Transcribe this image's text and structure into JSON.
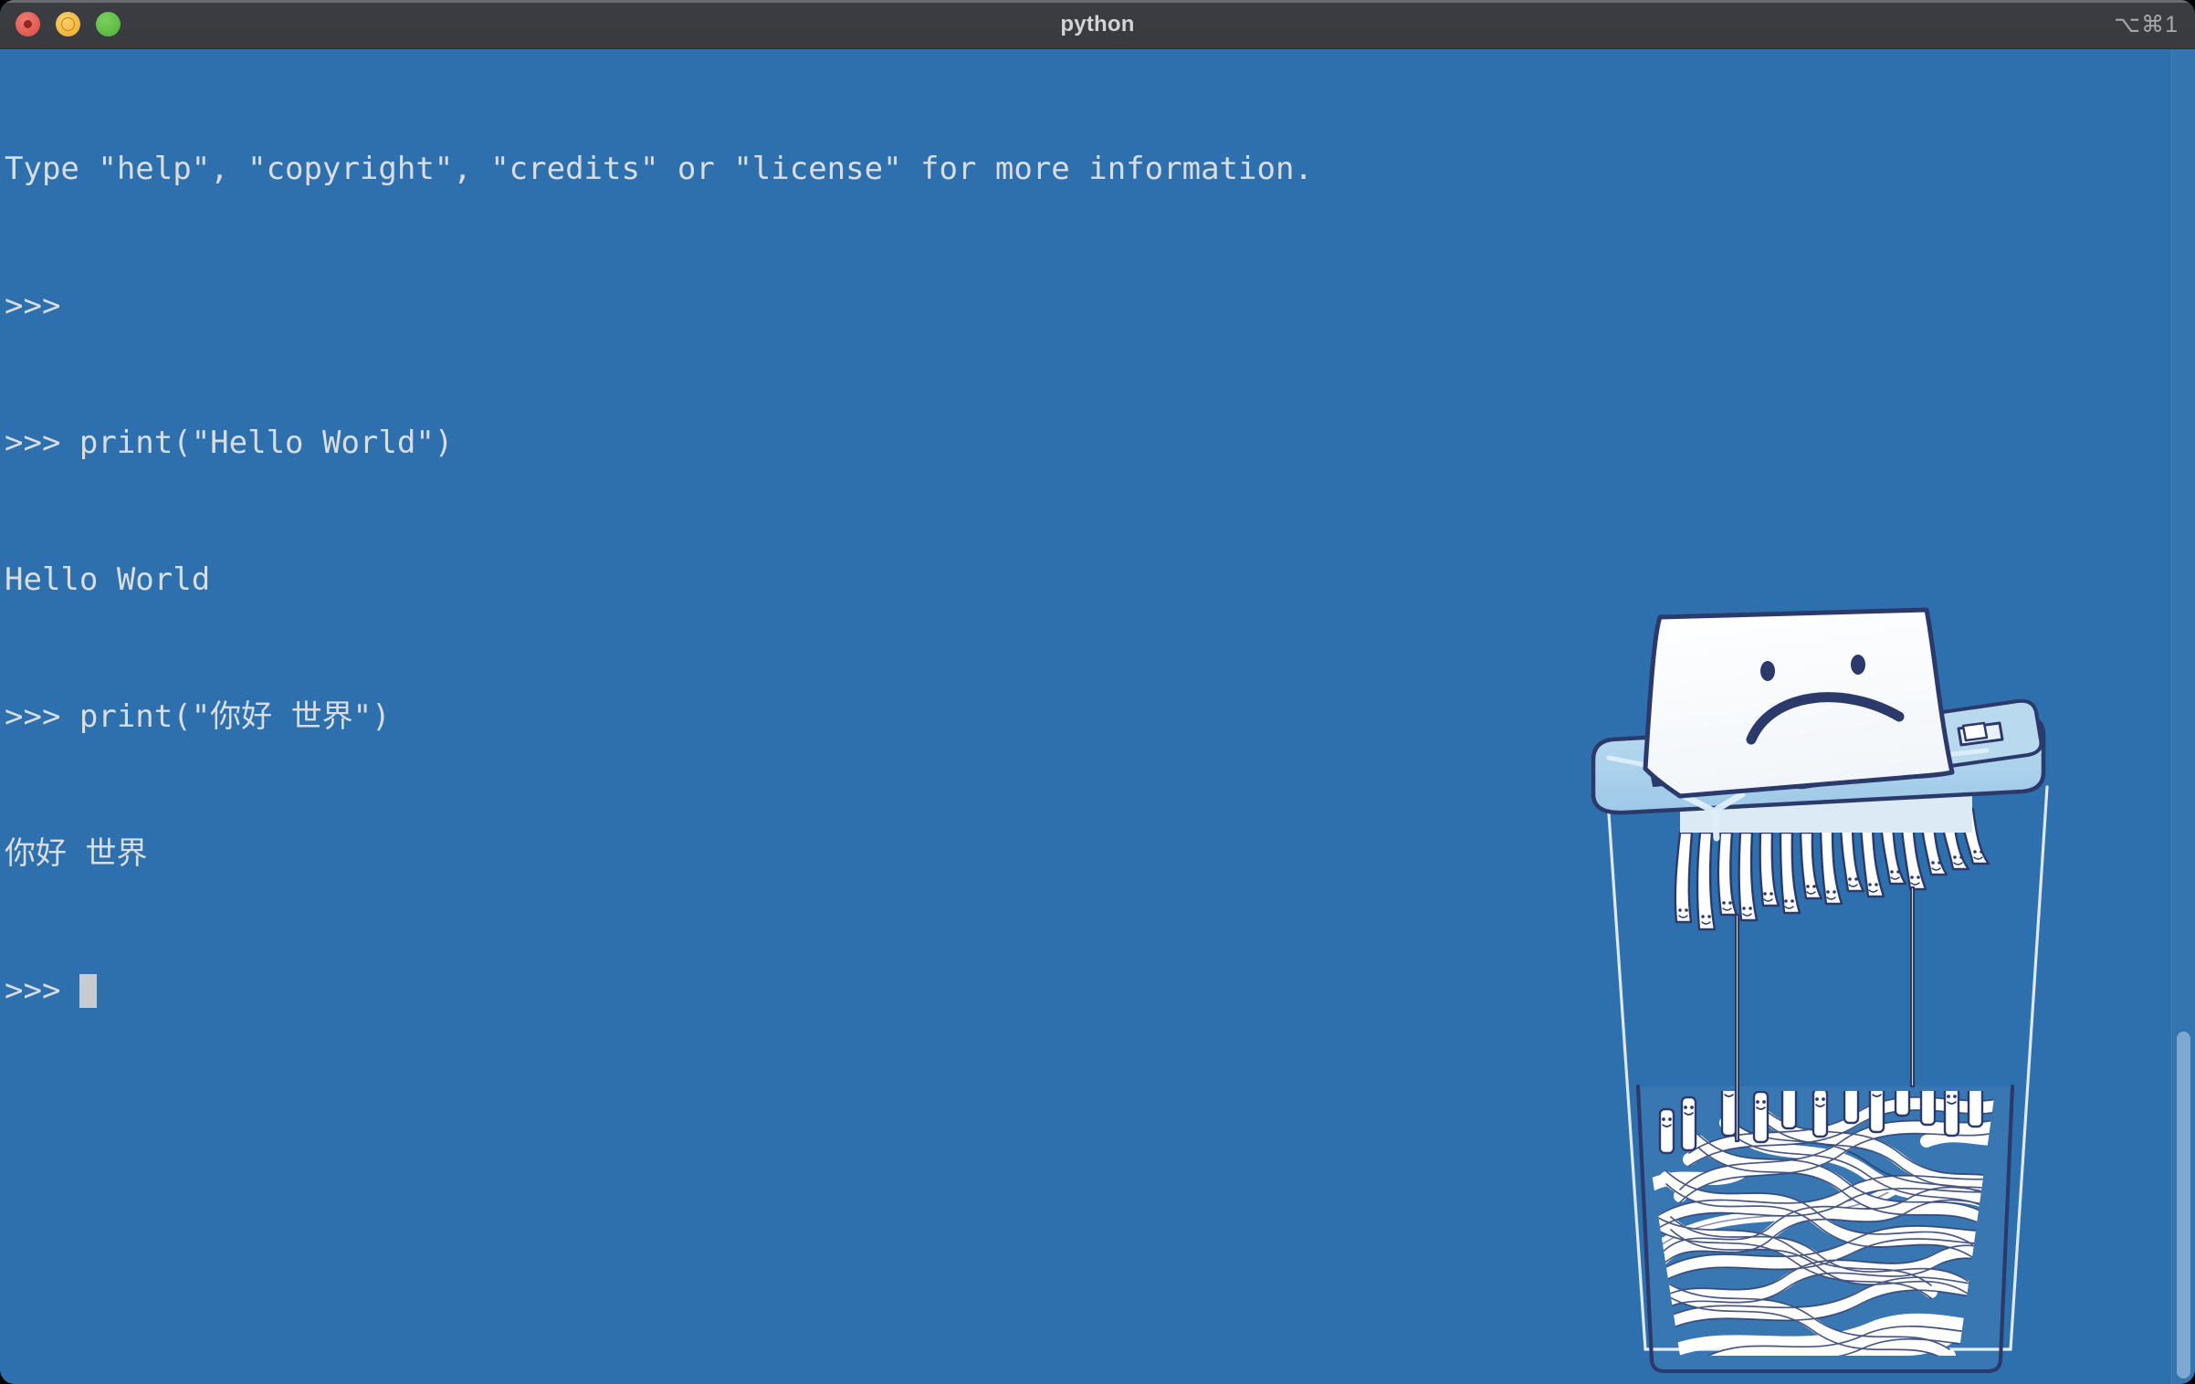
{
  "window": {
    "title": "python",
    "shortcut_hint": "⌥⌘1",
    "traffic_lights": [
      {
        "name": "close",
        "color": "#e05a52"
      },
      {
        "name": "minimize",
        "color": "#efb53f"
      },
      {
        "name": "zoom",
        "color": "#5cba43"
      }
    ]
  },
  "theme": {
    "terminal_background": "#2E70AD",
    "terminal_foreground": "#d9dde0",
    "titlebar_background": "#3a3b40",
    "titlebar_foreground": "#d3d3d5",
    "cursor_color": "#c9ccce",
    "scrollbar_thumb": "#7fa8d0",
    "illustration_ink": "#2b3a6b",
    "illustration_body": "#a9cfeb",
    "illustration_paper": "#ffffff"
  },
  "terminal": {
    "lines": [
      "Type \"help\", \"copyright\", \"credits\" or \"license\" for more information.",
      ">>> ",
      ">>> print(\"Hello World\")",
      "Hello World",
      ">>> print(\"你好 世界\")",
      "你好 世界"
    ],
    "prompt": ">>> ",
    "cursor_visible": true
  },
  "illustration": {
    "name": "sad-paper-shredder",
    "description": "Paper with a sad face being fed into a shredder, shredded strips with smiley faces collecting in the bin below"
  }
}
